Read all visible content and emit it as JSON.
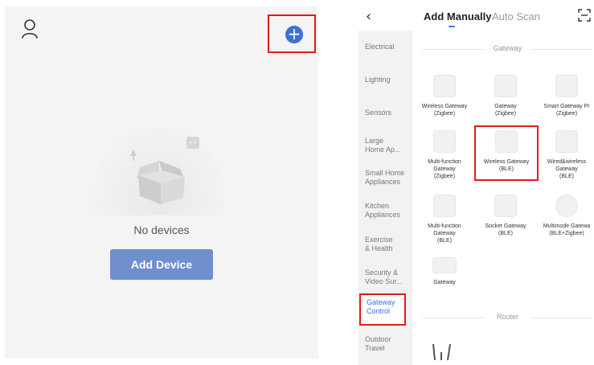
{
  "left_panel": {
    "empty_text": "No devices",
    "add_device_label": "Add Device",
    "add_icon_glyph": "+",
    "icons": [
      "person-icon",
      "add-circle-icon",
      "empty-box-illustration"
    ],
    "accent_color": "#3e6fd8",
    "highlight_color": "#e11a1a"
  },
  "right_panel": {
    "back_glyph": "‹",
    "tabs": [
      {
        "label": "Add Manually",
        "active": true
      },
      {
        "label": "Auto Scan",
        "active": false
      }
    ],
    "scan_icon": "scan-frame-icon",
    "categories": [
      {
        "label": "Electrical"
      },
      {
        "label": "Lighting"
      },
      {
        "label": "Sensors"
      },
      {
        "label": "Large\nHome Ap..."
      },
      {
        "label": "Small Home\nAppliances"
      },
      {
        "label": "Kitchen\nAppliances"
      },
      {
        "label": "Exercise\n& Health"
      },
      {
        "label": "Security &\nVideo Sur..."
      },
      {
        "label": "Gateway\nControl",
        "active": true
      },
      {
        "label": "Outdoor\nTravel"
      }
    ],
    "sections": [
      {
        "title": "Gateway"
      },
      {
        "title": "Router"
      }
    ],
    "devices": [
      {
        "name": "Wireless Gateway\n(Zigbee)"
      },
      {
        "name": "Gateway\n(Zigbee)"
      },
      {
        "name": "Smart Gateway Pr\n(Zigbee)"
      },
      {
        "name": "Multi-function\nGateway\n(Zigbee)"
      },
      {
        "name": "Wireless Gateway\n(BLE)",
        "highlighted": true
      },
      {
        "name": "Wired&wireless\nGateway\n(BLE)"
      },
      {
        "name": "Multi-function\nGateway\n(BLE)"
      },
      {
        "name": "Socket Gateway\n(BLE)"
      },
      {
        "name": "Multimode Gatewa\n(BLE+Zigbee)"
      },
      {
        "name": "Gateway"
      }
    ]
  }
}
